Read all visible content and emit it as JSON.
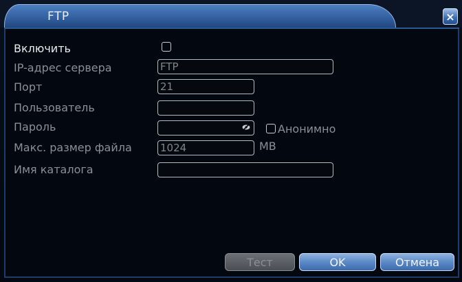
{
  "window": {
    "title": "FTP",
    "close_glyph": "×"
  },
  "form": {
    "enable": {
      "label": "Включить",
      "checked": false
    },
    "server_ip": {
      "label": "IP-адрес сервера",
      "value": "FTP"
    },
    "port": {
      "label": "Порт",
      "value": "21"
    },
    "user": {
      "label": "Пользователь",
      "value": ""
    },
    "password": {
      "label": "Пароль",
      "value": "",
      "anonymous_label": "Анонимно",
      "anonymous_checked": false
    },
    "max_file_size": {
      "label": "Макс. размер файла",
      "value": "1024",
      "unit": "MB"
    },
    "directory_name": {
      "label": "Имя каталога",
      "value": ""
    }
  },
  "buttons": {
    "test_label": "Тест",
    "ok_label": "OK",
    "cancel_label": "Отмена"
  },
  "colors": {
    "title_bar": "#335f9f",
    "active_text": "#e9ecf2",
    "disabled_text": "#8b8f98",
    "button_blue": "#5c89c7",
    "button_disabled": "#4b4e54"
  },
  "icons": {
    "close": "close-icon",
    "password_visibility": "eye-hidden-icon"
  }
}
